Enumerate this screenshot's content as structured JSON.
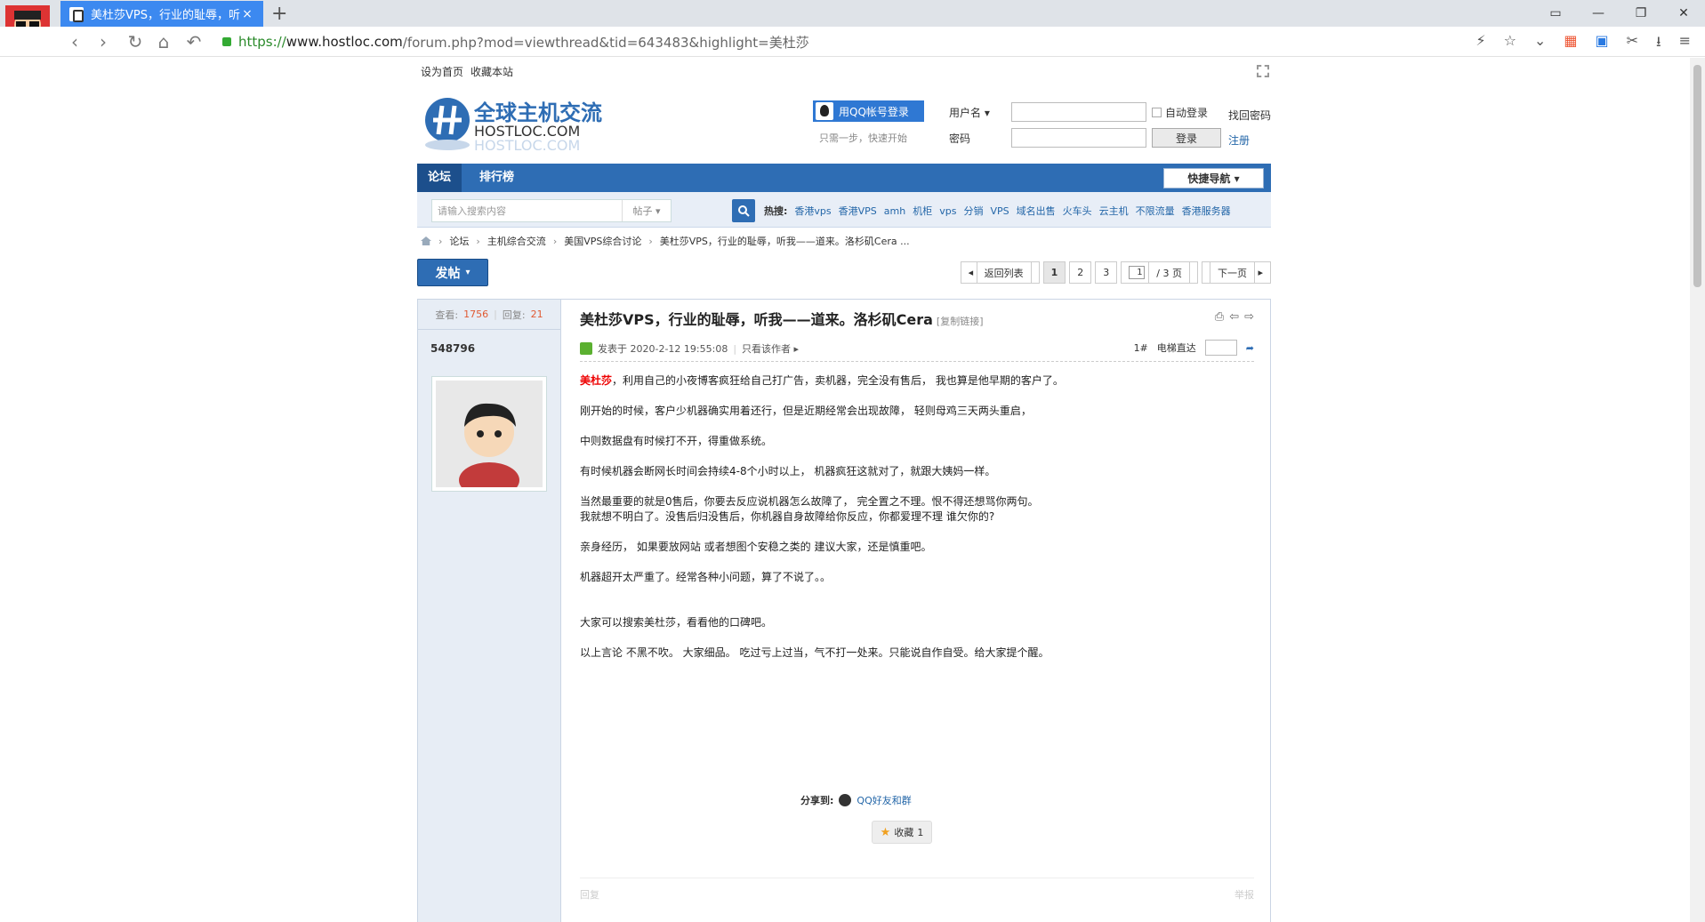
{
  "browser": {
    "tab_title": "美杜莎VPS，行业的耻辱，听我",
    "tab_close": "×",
    "new_tab": "+",
    "url_scheme": "https://",
    "url_host": "www.hostloc.com",
    "url_path": "/forum.php?mod=viewthread&tid=643483&highlight=美杜莎"
  },
  "topbar": {
    "sethome": "设为首页",
    "favsite": "收藏本站"
  },
  "header": {
    "qq_login": "用QQ帐号登录",
    "qq_hint": "只需一步，快速开始",
    "username_label": "用户名",
    "password_label": "密码",
    "auto_login": "自动登录",
    "login_btn": "登录",
    "find_password": "找回密码",
    "register": "注册"
  },
  "nav": {
    "items": [
      "论坛",
      "排行榜"
    ],
    "quick": "快捷导航"
  },
  "search": {
    "placeholder": "请输入搜索内容",
    "category": "帖子",
    "hot_label": "热搜:",
    "hot": [
      "香港vps",
      "香港VPS",
      "amh",
      "机柜",
      "vps",
      "分销",
      "VPS",
      "域名出售",
      "火车头",
      "云主机",
      "不限流量",
      "香港服务器"
    ]
  },
  "breadcrumb": [
    "论坛",
    "主机综合交流",
    "美国VPS综合讨论",
    "美杜莎VPS，行业的耻辱，听我——道来。洛杉矶Cera ..."
  ],
  "actions": {
    "post_btn": "发帖",
    "back_list": "返回列表",
    "pages": [
      "1",
      "2",
      "3"
    ],
    "page_input": "1",
    "page_total": "/ 3 页",
    "next": "下一页"
  },
  "post": {
    "views_label": "查看:",
    "views": "1756",
    "replies_label": "回复:",
    "replies": "21",
    "author": "548796",
    "title": "美杜莎VPS，行业的耻辱，听我——道来。洛杉矶Cera",
    "copy_link": "[复制链接]",
    "posted_at": "发表于 2020-2-12 19:55:08",
    "only_author": "只看该作者",
    "floor": "1#",
    "jump_label": "电梯直达",
    "keyword": "美杜莎",
    "paragraphs": [
      "，利用自己的小夜博客疯狂给自己打广告，卖机器，完全没有售后， 我也算是他早期的客户了。",
      "刚开始的时候，客户少机器确实用着还行，但是近期经常会出现故障， 轻则母鸡三天两头重启，",
      "中则数据盘有时候打不开，得重做系统。",
      "有时候机器会断网长时间会持续4-8个小时以上， 机器疯狂这就对了，就跟大姨妈一样。",
      "当然最重要的就是0售后，你要去反应说机器怎么故障了， 完全置之不理。恨不得还想骂你两句。",
      "我就想不明白了。没售后归没售后，你机器自身故障给你反应，你都爱理不理 谁欠你的?",
      "亲身经历， 如果要放网站 或者想图个安稳之类的 建议大家，还是慎重吧。",
      "机器超开太严重了。经常各种小问题，算了不说了。。",
      "大家可以搜索美杜莎，看看他的口碑吧。",
      "以上言论 不黑不吹。 大家细品。 吃过亏上过当，气不打一处来。只能说自作自受。给大家提个醒。"
    ],
    "share_label": "分享到:",
    "share_qq": "QQ好友和群",
    "fav_label": "收藏",
    "fav_count": "1",
    "reply": "回复",
    "report": "举报"
  }
}
